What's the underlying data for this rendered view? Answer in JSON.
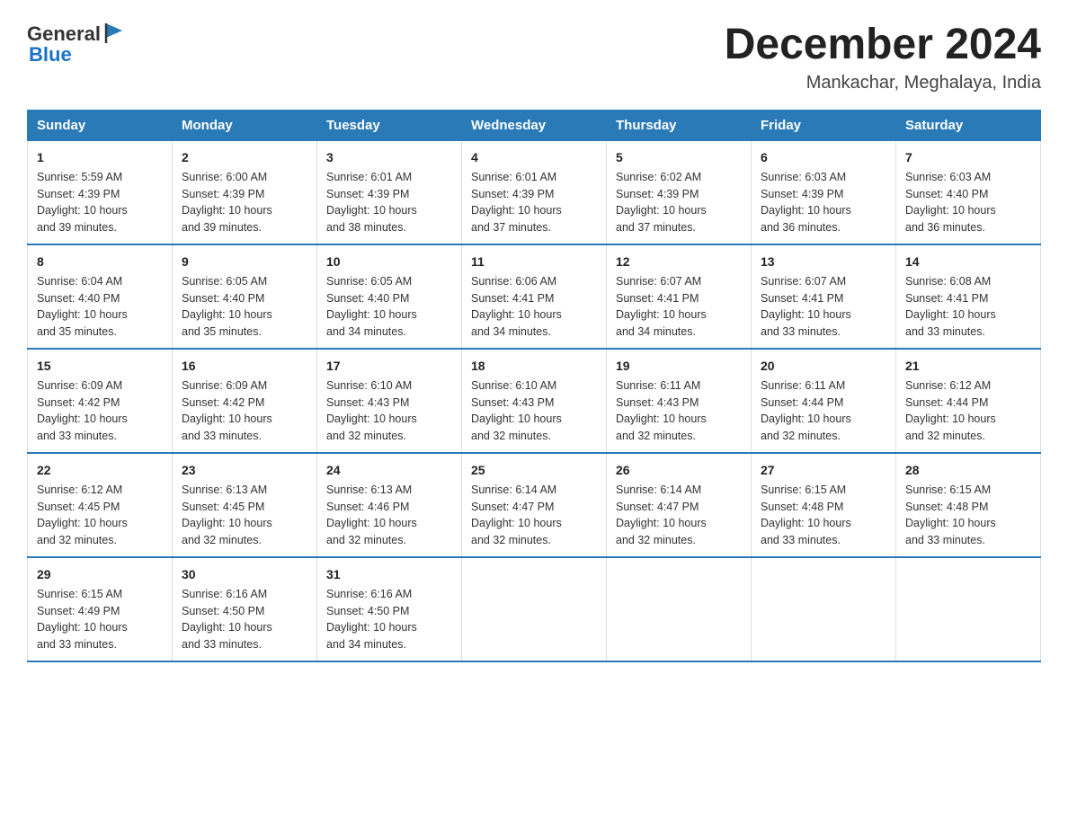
{
  "logo": {
    "general": "General",
    "blue": "Blue"
  },
  "header": {
    "month_year": "December 2024",
    "location": "Mankachar, Meghalaya, India"
  },
  "days_of_week": [
    "Sunday",
    "Monday",
    "Tuesday",
    "Wednesday",
    "Thursday",
    "Friday",
    "Saturday"
  ],
  "weeks": [
    [
      {
        "day": "1",
        "info": "Sunrise: 5:59 AM\nSunset: 4:39 PM\nDaylight: 10 hours\nand 39 minutes."
      },
      {
        "day": "2",
        "info": "Sunrise: 6:00 AM\nSunset: 4:39 PM\nDaylight: 10 hours\nand 39 minutes."
      },
      {
        "day": "3",
        "info": "Sunrise: 6:01 AM\nSunset: 4:39 PM\nDaylight: 10 hours\nand 38 minutes."
      },
      {
        "day": "4",
        "info": "Sunrise: 6:01 AM\nSunset: 4:39 PM\nDaylight: 10 hours\nand 37 minutes."
      },
      {
        "day": "5",
        "info": "Sunrise: 6:02 AM\nSunset: 4:39 PM\nDaylight: 10 hours\nand 37 minutes."
      },
      {
        "day": "6",
        "info": "Sunrise: 6:03 AM\nSunset: 4:39 PM\nDaylight: 10 hours\nand 36 minutes."
      },
      {
        "day": "7",
        "info": "Sunrise: 6:03 AM\nSunset: 4:40 PM\nDaylight: 10 hours\nand 36 minutes."
      }
    ],
    [
      {
        "day": "8",
        "info": "Sunrise: 6:04 AM\nSunset: 4:40 PM\nDaylight: 10 hours\nand 35 minutes."
      },
      {
        "day": "9",
        "info": "Sunrise: 6:05 AM\nSunset: 4:40 PM\nDaylight: 10 hours\nand 35 minutes."
      },
      {
        "day": "10",
        "info": "Sunrise: 6:05 AM\nSunset: 4:40 PM\nDaylight: 10 hours\nand 34 minutes."
      },
      {
        "day": "11",
        "info": "Sunrise: 6:06 AM\nSunset: 4:41 PM\nDaylight: 10 hours\nand 34 minutes."
      },
      {
        "day": "12",
        "info": "Sunrise: 6:07 AM\nSunset: 4:41 PM\nDaylight: 10 hours\nand 34 minutes."
      },
      {
        "day": "13",
        "info": "Sunrise: 6:07 AM\nSunset: 4:41 PM\nDaylight: 10 hours\nand 33 minutes."
      },
      {
        "day": "14",
        "info": "Sunrise: 6:08 AM\nSunset: 4:41 PM\nDaylight: 10 hours\nand 33 minutes."
      }
    ],
    [
      {
        "day": "15",
        "info": "Sunrise: 6:09 AM\nSunset: 4:42 PM\nDaylight: 10 hours\nand 33 minutes."
      },
      {
        "day": "16",
        "info": "Sunrise: 6:09 AM\nSunset: 4:42 PM\nDaylight: 10 hours\nand 33 minutes."
      },
      {
        "day": "17",
        "info": "Sunrise: 6:10 AM\nSunset: 4:43 PM\nDaylight: 10 hours\nand 32 minutes."
      },
      {
        "day": "18",
        "info": "Sunrise: 6:10 AM\nSunset: 4:43 PM\nDaylight: 10 hours\nand 32 minutes."
      },
      {
        "day": "19",
        "info": "Sunrise: 6:11 AM\nSunset: 4:43 PM\nDaylight: 10 hours\nand 32 minutes."
      },
      {
        "day": "20",
        "info": "Sunrise: 6:11 AM\nSunset: 4:44 PM\nDaylight: 10 hours\nand 32 minutes."
      },
      {
        "day": "21",
        "info": "Sunrise: 6:12 AM\nSunset: 4:44 PM\nDaylight: 10 hours\nand 32 minutes."
      }
    ],
    [
      {
        "day": "22",
        "info": "Sunrise: 6:12 AM\nSunset: 4:45 PM\nDaylight: 10 hours\nand 32 minutes."
      },
      {
        "day": "23",
        "info": "Sunrise: 6:13 AM\nSunset: 4:45 PM\nDaylight: 10 hours\nand 32 minutes."
      },
      {
        "day": "24",
        "info": "Sunrise: 6:13 AM\nSunset: 4:46 PM\nDaylight: 10 hours\nand 32 minutes."
      },
      {
        "day": "25",
        "info": "Sunrise: 6:14 AM\nSunset: 4:47 PM\nDaylight: 10 hours\nand 32 minutes."
      },
      {
        "day": "26",
        "info": "Sunrise: 6:14 AM\nSunset: 4:47 PM\nDaylight: 10 hours\nand 32 minutes."
      },
      {
        "day": "27",
        "info": "Sunrise: 6:15 AM\nSunset: 4:48 PM\nDaylight: 10 hours\nand 33 minutes."
      },
      {
        "day": "28",
        "info": "Sunrise: 6:15 AM\nSunset: 4:48 PM\nDaylight: 10 hours\nand 33 minutes."
      }
    ],
    [
      {
        "day": "29",
        "info": "Sunrise: 6:15 AM\nSunset: 4:49 PM\nDaylight: 10 hours\nand 33 minutes."
      },
      {
        "day": "30",
        "info": "Sunrise: 6:16 AM\nSunset: 4:50 PM\nDaylight: 10 hours\nand 33 minutes."
      },
      {
        "day": "31",
        "info": "Sunrise: 6:16 AM\nSunset: 4:50 PM\nDaylight: 10 hours\nand 34 minutes."
      },
      {
        "day": "",
        "info": ""
      },
      {
        "day": "",
        "info": ""
      },
      {
        "day": "",
        "info": ""
      },
      {
        "day": "",
        "info": ""
      }
    ]
  ]
}
